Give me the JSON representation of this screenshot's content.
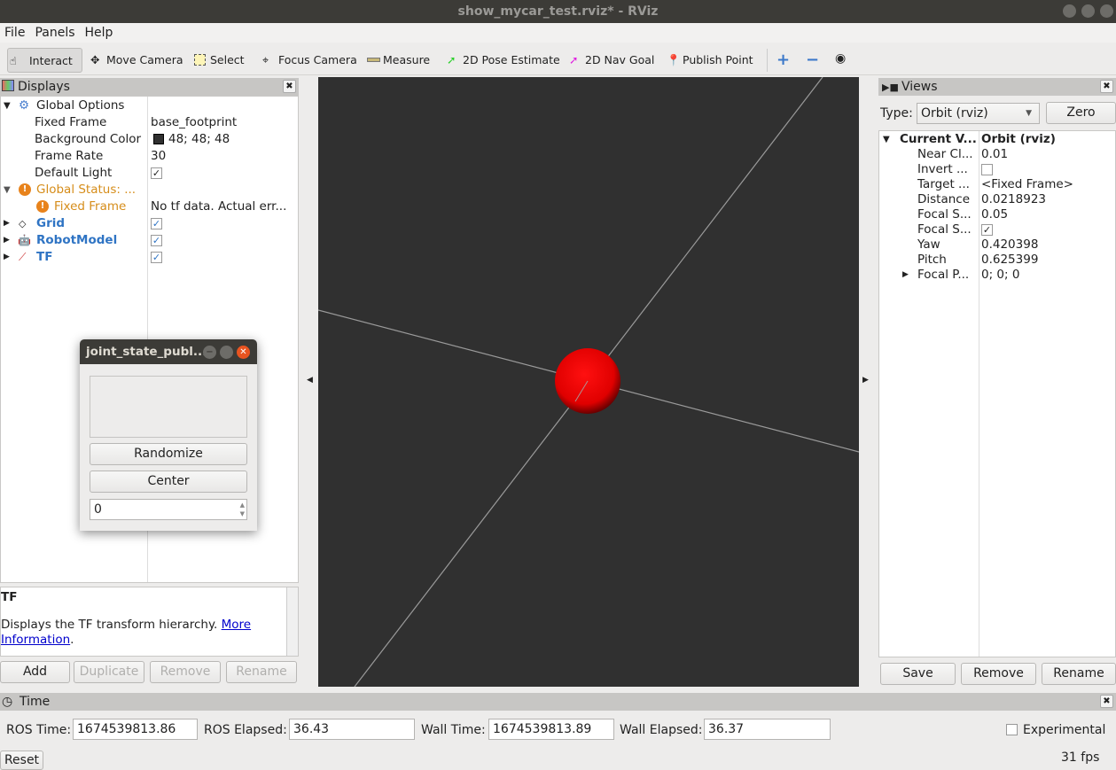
{
  "window": {
    "title": "show_mycar_test.rviz* - RViz"
  },
  "menu": [
    "File",
    "Panels",
    "Help"
  ],
  "toolbar": {
    "tools": [
      {
        "label": "Interact",
        "icon": "hand-pointer-icon",
        "active": true
      },
      {
        "label": "Move Camera",
        "icon": "move-camera-icon"
      },
      {
        "label": "Select",
        "icon": "select-box-icon"
      },
      {
        "label": "Focus Camera",
        "icon": "crosshair-icon"
      },
      {
        "label": "Measure",
        "icon": "ruler-icon"
      },
      {
        "label": "2D Pose Estimate",
        "icon": "green-arrow-icon"
      },
      {
        "label": "2D Nav Goal",
        "icon": "magenta-arrow-icon"
      },
      {
        "label": "Publish Point",
        "icon": "map-pin-icon"
      }
    ]
  },
  "displays": {
    "title": "Displays",
    "global_options": "Global Options",
    "options": [
      {
        "k": "Fixed Frame",
        "v": "base_footprint"
      },
      {
        "k": "Background Color",
        "v": "48; 48; 48",
        "swatch": "#303030"
      },
      {
        "k": "Frame Rate",
        "v": "30"
      },
      {
        "k": "Default Light",
        "checked": true
      }
    ],
    "global_status": "Global Status: ...",
    "status_fixed_frame": {
      "k": "Fixed Frame",
      "v": "No tf data.  Actual err..."
    },
    "items": [
      {
        "label": "Grid",
        "checked": true
      },
      {
        "label": "RobotModel",
        "checked": true
      },
      {
        "label": "TF",
        "checked": true
      }
    ],
    "desc_title": "TF",
    "desc_text": "Displays the TF transform hierarchy. ",
    "desc_link1": "More",
    "desc_link2": "Information",
    "buttons": {
      "add": "Add",
      "duplicate": "Duplicate",
      "remove": "Remove",
      "rename": "Rename"
    }
  },
  "joint_dialog": {
    "title": "joint_state_publ...",
    "randomize": "Randomize",
    "center": "Center",
    "value": "0"
  },
  "views": {
    "title": "Views",
    "type_label": "Type:",
    "type_value": "Orbit (rviz)",
    "zero": "Zero",
    "current": {
      "k": "Current V...",
      "v": "Orbit (rviz)"
    },
    "props": [
      {
        "k": "Near Cl...",
        "v": "0.01"
      },
      {
        "k": "Invert ...",
        "checked": false
      },
      {
        "k": "Target ...",
        "v": "<Fixed Frame>"
      },
      {
        "k": "Distance",
        "v": "0.0218923"
      },
      {
        "k": "Focal S...",
        "v": "0.05"
      },
      {
        "k": "Focal S...",
        "checked": true
      },
      {
        "k": "Yaw",
        "v": "0.420398"
      },
      {
        "k": "Pitch",
        "v": "0.625399"
      },
      {
        "k": "Focal P...",
        "v": "0; 0; 0"
      }
    ],
    "buttons": {
      "save": "Save",
      "remove": "Remove",
      "rename": "Rename"
    }
  },
  "time": {
    "title": "Time",
    "ros_time_label": "ROS Time:",
    "ros_time": "1674539813.86",
    "ros_elapsed_label": "ROS Elapsed:",
    "ros_elapsed": "36.43",
    "wall_time_label": "Wall Time:",
    "wall_time": "1674539813.89",
    "wall_elapsed_label": "Wall Elapsed:",
    "wall_elapsed": "36.37",
    "experimental": "Experimental",
    "reset": "Reset",
    "fps": "31 fps"
  },
  "colors": {
    "viewport_bg": "#303030",
    "sphere": "#ff0000"
  }
}
